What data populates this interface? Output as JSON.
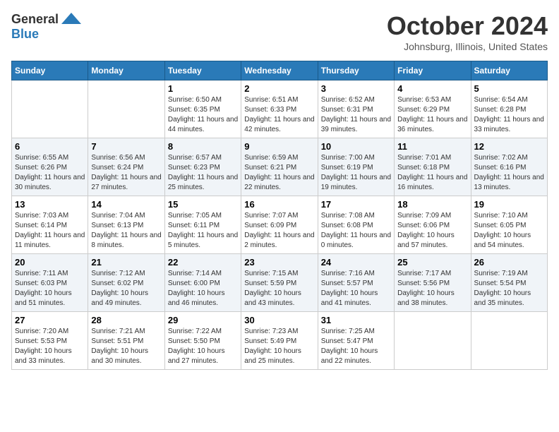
{
  "logo": {
    "general": "General",
    "blue": "Blue"
  },
  "header": {
    "month": "October 2024",
    "location": "Johnsburg, Illinois, United States"
  },
  "weekdays": [
    "Sunday",
    "Monday",
    "Tuesday",
    "Wednesday",
    "Thursday",
    "Friday",
    "Saturday"
  ],
  "weeks": [
    [
      {
        "day": "",
        "info": ""
      },
      {
        "day": "",
        "info": ""
      },
      {
        "day": "1",
        "sunrise": "6:50 AM",
        "sunset": "6:35 PM",
        "daylight": "11 hours and 44 minutes."
      },
      {
        "day": "2",
        "sunrise": "6:51 AM",
        "sunset": "6:33 PM",
        "daylight": "11 hours and 42 minutes."
      },
      {
        "day": "3",
        "sunrise": "6:52 AM",
        "sunset": "6:31 PM",
        "daylight": "11 hours and 39 minutes."
      },
      {
        "day": "4",
        "sunrise": "6:53 AM",
        "sunset": "6:29 PM",
        "daylight": "11 hours and 36 minutes."
      },
      {
        "day": "5",
        "sunrise": "6:54 AM",
        "sunset": "6:28 PM",
        "daylight": "11 hours and 33 minutes."
      }
    ],
    [
      {
        "day": "6",
        "sunrise": "6:55 AM",
        "sunset": "6:26 PM",
        "daylight": "11 hours and 30 minutes."
      },
      {
        "day": "7",
        "sunrise": "6:56 AM",
        "sunset": "6:24 PM",
        "daylight": "11 hours and 27 minutes."
      },
      {
        "day": "8",
        "sunrise": "6:57 AM",
        "sunset": "6:23 PM",
        "daylight": "11 hours and 25 minutes."
      },
      {
        "day": "9",
        "sunrise": "6:59 AM",
        "sunset": "6:21 PM",
        "daylight": "11 hours and 22 minutes."
      },
      {
        "day": "10",
        "sunrise": "7:00 AM",
        "sunset": "6:19 PM",
        "daylight": "11 hours and 19 minutes."
      },
      {
        "day": "11",
        "sunrise": "7:01 AM",
        "sunset": "6:18 PM",
        "daylight": "11 hours and 16 minutes."
      },
      {
        "day": "12",
        "sunrise": "7:02 AM",
        "sunset": "6:16 PM",
        "daylight": "11 hours and 13 minutes."
      }
    ],
    [
      {
        "day": "13",
        "sunrise": "7:03 AM",
        "sunset": "6:14 PM",
        "daylight": "11 hours and 11 minutes."
      },
      {
        "day": "14",
        "sunrise": "7:04 AM",
        "sunset": "6:13 PM",
        "daylight": "11 hours and 8 minutes."
      },
      {
        "day": "15",
        "sunrise": "7:05 AM",
        "sunset": "6:11 PM",
        "daylight": "11 hours and 5 minutes."
      },
      {
        "day": "16",
        "sunrise": "7:07 AM",
        "sunset": "6:09 PM",
        "daylight": "11 hours and 2 minutes."
      },
      {
        "day": "17",
        "sunrise": "7:08 AM",
        "sunset": "6:08 PM",
        "daylight": "11 hours and 0 minutes."
      },
      {
        "day": "18",
        "sunrise": "7:09 AM",
        "sunset": "6:06 PM",
        "daylight": "10 hours and 57 minutes."
      },
      {
        "day": "19",
        "sunrise": "7:10 AM",
        "sunset": "6:05 PM",
        "daylight": "10 hours and 54 minutes."
      }
    ],
    [
      {
        "day": "20",
        "sunrise": "7:11 AM",
        "sunset": "6:03 PM",
        "daylight": "10 hours and 51 minutes."
      },
      {
        "day": "21",
        "sunrise": "7:12 AM",
        "sunset": "6:02 PM",
        "daylight": "10 hours and 49 minutes."
      },
      {
        "day": "22",
        "sunrise": "7:14 AM",
        "sunset": "6:00 PM",
        "daylight": "10 hours and 46 minutes."
      },
      {
        "day": "23",
        "sunrise": "7:15 AM",
        "sunset": "5:59 PM",
        "daylight": "10 hours and 43 minutes."
      },
      {
        "day": "24",
        "sunrise": "7:16 AM",
        "sunset": "5:57 PM",
        "daylight": "10 hours and 41 minutes."
      },
      {
        "day": "25",
        "sunrise": "7:17 AM",
        "sunset": "5:56 PM",
        "daylight": "10 hours and 38 minutes."
      },
      {
        "day": "26",
        "sunrise": "7:19 AM",
        "sunset": "5:54 PM",
        "daylight": "10 hours and 35 minutes."
      }
    ],
    [
      {
        "day": "27",
        "sunrise": "7:20 AM",
        "sunset": "5:53 PM",
        "daylight": "10 hours and 33 minutes."
      },
      {
        "day": "28",
        "sunrise": "7:21 AM",
        "sunset": "5:51 PM",
        "daylight": "10 hours and 30 minutes."
      },
      {
        "day": "29",
        "sunrise": "7:22 AM",
        "sunset": "5:50 PM",
        "daylight": "10 hours and 27 minutes."
      },
      {
        "day": "30",
        "sunrise": "7:23 AM",
        "sunset": "5:49 PM",
        "daylight": "10 hours and 25 minutes."
      },
      {
        "day": "31",
        "sunrise": "7:25 AM",
        "sunset": "5:47 PM",
        "daylight": "10 hours and 22 minutes."
      },
      {
        "day": "",
        "info": ""
      },
      {
        "day": "",
        "info": ""
      }
    ]
  ],
  "labels": {
    "sunrise": "Sunrise:",
    "sunset": "Sunset:",
    "daylight": "Daylight:"
  }
}
